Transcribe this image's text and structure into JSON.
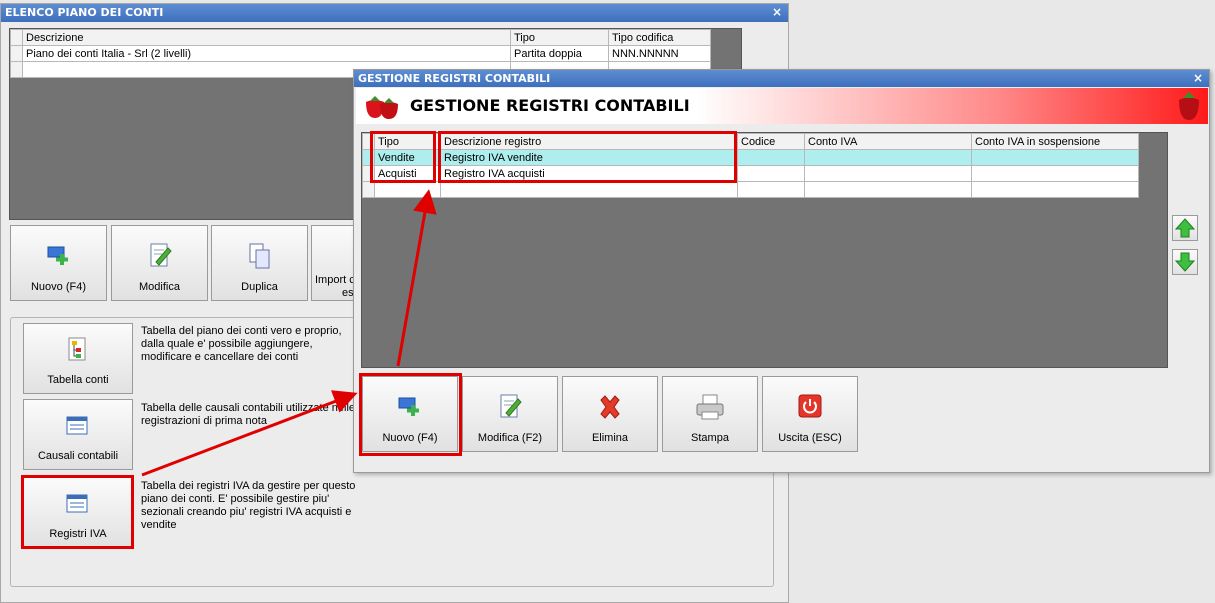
{
  "back_window": {
    "title": "ELENCO PIANO DEI CONTI",
    "close": "×",
    "grid": {
      "headers": [
        "Descrizione",
        "Tipo",
        "Tipo codifica"
      ],
      "rows": [
        [
          "Piano dei conti Italia - Srl (2 livelli)",
          "Partita doppia",
          "NNN.NNNNN"
        ]
      ]
    },
    "toolbar": {
      "new": "Nuovo (F4)",
      "edit": "Modifica",
      "duplicate": "Duplica",
      "import_line1": "Import c",
      "import_line2": "est"
    },
    "tables": {
      "conti_label": "Tabella conti",
      "conti_desc": "Tabella del piano dei conti vero e proprio, dalla quale e' possibile aggiungere, modificare e cancellare dei conti",
      "causali_label": "Causali contabili",
      "causali_desc": "Tabella delle causali contabili utilizzate nelle registrazioni di prima nota",
      "iva_label": "Registri IVA",
      "iva_desc": "Tabella dei registri IVA da gestire per questo piano dei conti. E' possibile gestire piu' sezionali creando piu' registri IVA acquisti e vendite"
    }
  },
  "front_window": {
    "title": "GESTIONE REGISTRI CONTABILI",
    "close": "×",
    "banner_title": "GESTIONE REGISTRI CONTABILI",
    "grid": {
      "headers": [
        "Tipo",
        "Descrizione registro",
        "Codice",
        "Conto IVA",
        "Conto IVA in sospensione"
      ],
      "rows": [
        [
          "Vendite",
          "Registro IVA vendite",
          "",
          "",
          ""
        ],
        [
          "Acquisti",
          "Registro IVA acquisti",
          "",
          "",
          ""
        ]
      ]
    },
    "toolbar": {
      "new": "Nuovo (F4)",
      "edit": "Modifica (F2)",
      "delete": "Elimina",
      "print": "Stampa",
      "exit": "Uscita (ESC)"
    }
  },
  "colors": {
    "title_bar": "#3d6fbe",
    "highlight": "#e00000",
    "selected_row": "#aeeeee",
    "grid_bg": "#737373",
    "banner_end": "#ff1a1a"
  }
}
